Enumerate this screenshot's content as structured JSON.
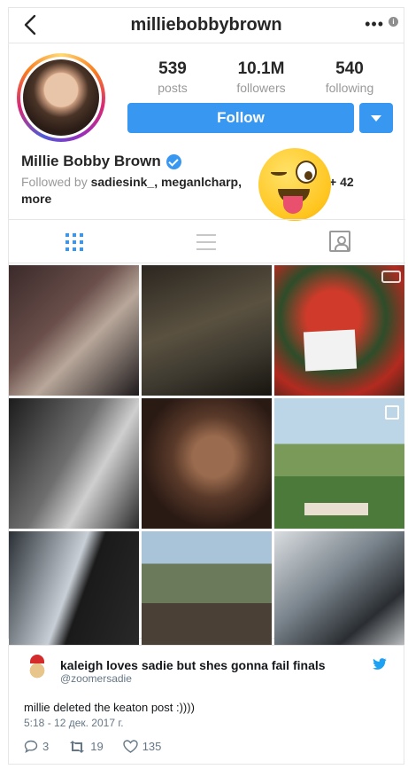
{
  "profile": {
    "username": "milliebobbybrown",
    "menu_dots": "•••",
    "info": "i",
    "full_name": "Millie Bobby Brown",
    "stats": [
      {
        "value": "539",
        "label": "posts"
      },
      {
        "value": "10.1M",
        "label": "followers"
      },
      {
        "value": "540",
        "label": "following"
      }
    ],
    "follow_label": "Follow",
    "followed_by_prefix": "Followed by ",
    "followed_by_names": "sadiesink_, meganlcharp,",
    "followed_by_more": "+ 42",
    "followed_by_more_word": "more"
  },
  "tweet": {
    "name": "kaleigh loves sadie but shes gonna fail finals",
    "handle": "@zoomersadie",
    "text": "millie deleted the keaton post :))))",
    "date": "5:18 - 12 дек. 2017 г.",
    "replies": "3",
    "retweets": "19",
    "likes": "135"
  },
  "colors": {
    "accent": "#3897f0",
    "twitter": "#1da1f2"
  }
}
